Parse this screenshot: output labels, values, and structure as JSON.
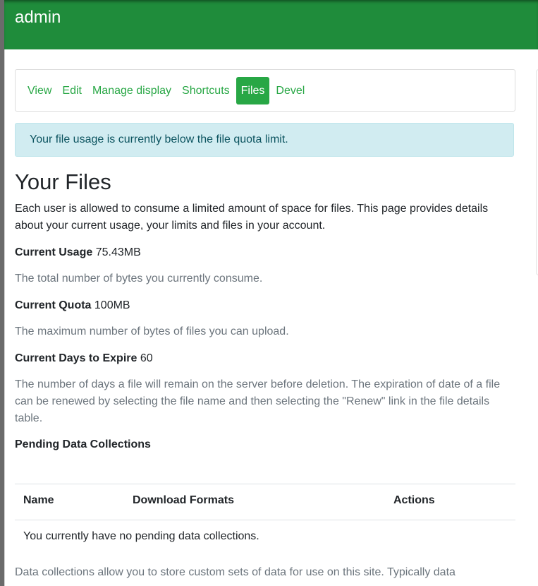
{
  "header": {
    "title": "admin"
  },
  "tabs": [
    {
      "label": "View",
      "active": false
    },
    {
      "label": "Edit",
      "active": false
    },
    {
      "label": "Manage display",
      "active": false
    },
    {
      "label": "Shortcuts",
      "active": false
    },
    {
      "label": "Files",
      "active": true
    },
    {
      "label": "Devel",
      "active": false
    }
  ],
  "alert": {
    "text": "Your file usage is currently below the file quota limit."
  },
  "page": {
    "title": "Your Files",
    "intro": "Each user is allowed to consume a limited amount of space for files. This page provides details about your current usage, your limits and files in your account."
  },
  "stats": {
    "usage_label": "Current Usage",
    "usage_value": "75.43MB",
    "usage_desc": "The total number of bytes you currently consume.",
    "quota_label": "Current Quota",
    "quota_value": "100MB",
    "quota_desc": "The maximum number of bytes of files you can upload.",
    "expire_label": "Current Days to Expire",
    "expire_value": "60",
    "expire_desc": "The number of days a file will remain on the server before deletion. The expiration of date of a file can be renewed by selecting the file name and then selecting the \"Renew\" link in the file details table."
  },
  "pending": {
    "heading": "Pending Data Collections",
    "columns": [
      "Name",
      "Download Formats",
      "Actions"
    ],
    "empty_message": "You currently have no pending data collections."
  },
  "footer": {
    "text": "Data collections allow you to store custom sets of data for use on this site. Typically data"
  },
  "colors": {
    "header_bg": "#1f8c3b",
    "accent": "#28a745",
    "alert_bg": "#d1ecf1",
    "alert_text": "#0c5460",
    "muted_text": "#6c757d"
  }
}
